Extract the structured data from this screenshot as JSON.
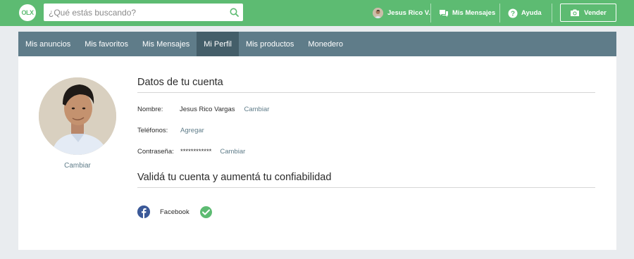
{
  "header": {
    "logo": "OLX",
    "search_placeholder": "¿Qué estás buscando?",
    "user_name": "Jesus Rico V.",
    "messages_label": "Mis Mensajes",
    "help_label": "Ayuda",
    "sell_label": "Vender"
  },
  "tabs": [
    {
      "label": "Mis anuncios"
    },
    {
      "label": "Mis favoritos"
    },
    {
      "label": "Mis Mensajes"
    },
    {
      "label": "Mi Perfil",
      "active": true
    },
    {
      "label": "Mis productos"
    },
    {
      "label": "Monedero"
    }
  ],
  "profile": {
    "photo_change_label": "Cambiar"
  },
  "account": {
    "title": "Datos de tu cuenta",
    "name_label": "Nombre:",
    "name_value": "Jesus Rico Vargas",
    "name_action": "Cambiar",
    "phones_label": "Teléfonos:",
    "phones_action": "Agregar",
    "password_label": "Contraseña:",
    "password_value": "************",
    "password_action": "Cambiar"
  },
  "validate": {
    "title": "Validá tu cuenta y aumentá tu confiabilidad",
    "facebook_label": "Facebook",
    "facebook_verified": true
  },
  "colors": {
    "brand_green": "#5dbb72",
    "tabs_bar": "#5f7c89",
    "tab_active": "#445e69",
    "link": "#5f7c89",
    "facebook_blue": "#3b5998"
  }
}
